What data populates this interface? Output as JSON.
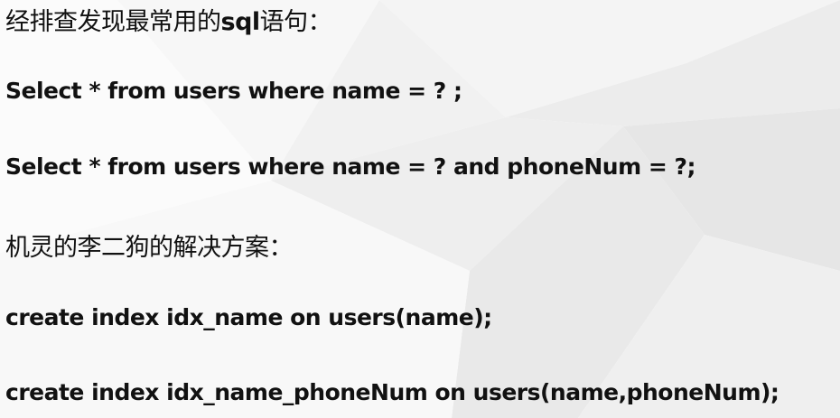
{
  "slide": {
    "heading_prefix": "经排查发现最常用的",
    "heading_sql": "sql",
    "heading_suffix": "语句：",
    "query_1": "Select  *  from users where name = ? ;",
    "query_2": "Select  *  from users where name = ? and phoneNum = ?;",
    "solution_heading": "机灵的李二狗的解决方案：",
    "index_1": "create index idx_name on users(name);",
    "index_2": "create index idx_name_phoneNum on users(name,phoneNum);"
  },
  "colors": {
    "text": "#111111",
    "background": "#ffffff",
    "facet_light": "#f3f3f3",
    "facet_mid": "#ebebeb",
    "facet_dark": "#e2e2e2"
  }
}
